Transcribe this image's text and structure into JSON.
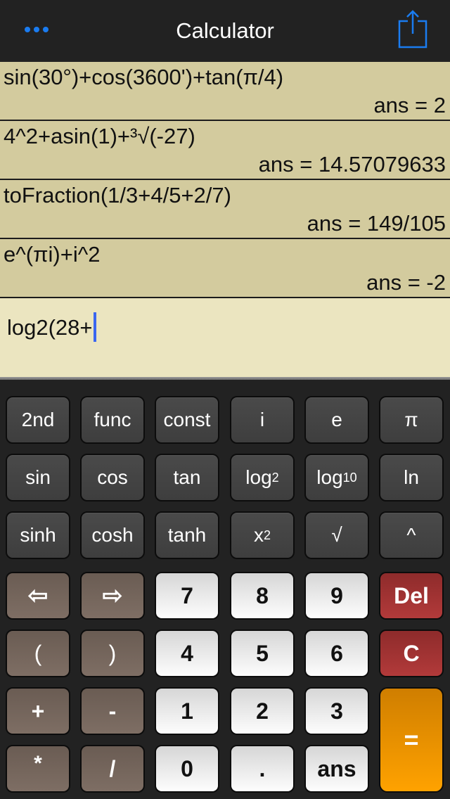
{
  "app": {
    "title": "Calculator",
    "more_icon": "ellipsis-icon",
    "share_icon": "share-icon",
    "accent_color": "#1a7cf0"
  },
  "history": [
    {
      "expression": "sin(30°)+cos(3600')+tan(π/4)",
      "answer": "ans = 2"
    },
    {
      "expression": "4^2+asin(1)+³√(-27)",
      "answer": "ans = 14.57079633"
    },
    {
      "expression": "toFraction(1/3+4/5+2/7)",
      "answer": "ans = 149/105"
    },
    {
      "expression": "e^(πi)+i^2",
      "answer": "ans = -2"
    }
  ],
  "input": {
    "value": "log2(28+"
  },
  "keys": {
    "row1": [
      "2nd",
      "func",
      "const",
      "i",
      "e",
      "π"
    ],
    "row2": {
      "sin": "sin",
      "cos": "cos",
      "tan": "tan",
      "log2_base": "log",
      "log2_sub": "2",
      "log10_base": "log",
      "log10_sub": "10",
      "ln": "ln"
    },
    "row3": {
      "sinh": "sinh",
      "cosh": "cosh",
      "tanh": "tanh",
      "sq_base": "x",
      "sq_sup": "2",
      "sqrt": "√",
      "pow": "^"
    },
    "left_arrow": "⇦",
    "right_arrow": "⇨",
    "digits": [
      "0",
      "1",
      "2",
      "3",
      "4",
      "5",
      "6",
      "7",
      "8",
      "9"
    ],
    "del": "Del",
    "clear": "C",
    "open_paren": "(",
    "close_paren": ")",
    "plus": "+",
    "minus": "-",
    "multiply": "*",
    "divide": "/",
    "dot": ".",
    "ans": "ans",
    "equals": "="
  },
  "colors": {
    "history_bg": "#d3cb9e",
    "input_bg": "#ebe5c0",
    "keypad_bg": "#222222",
    "equals_key": "#ffa200",
    "delete_key": "#b23a3a",
    "caret": "#3a66f0"
  }
}
